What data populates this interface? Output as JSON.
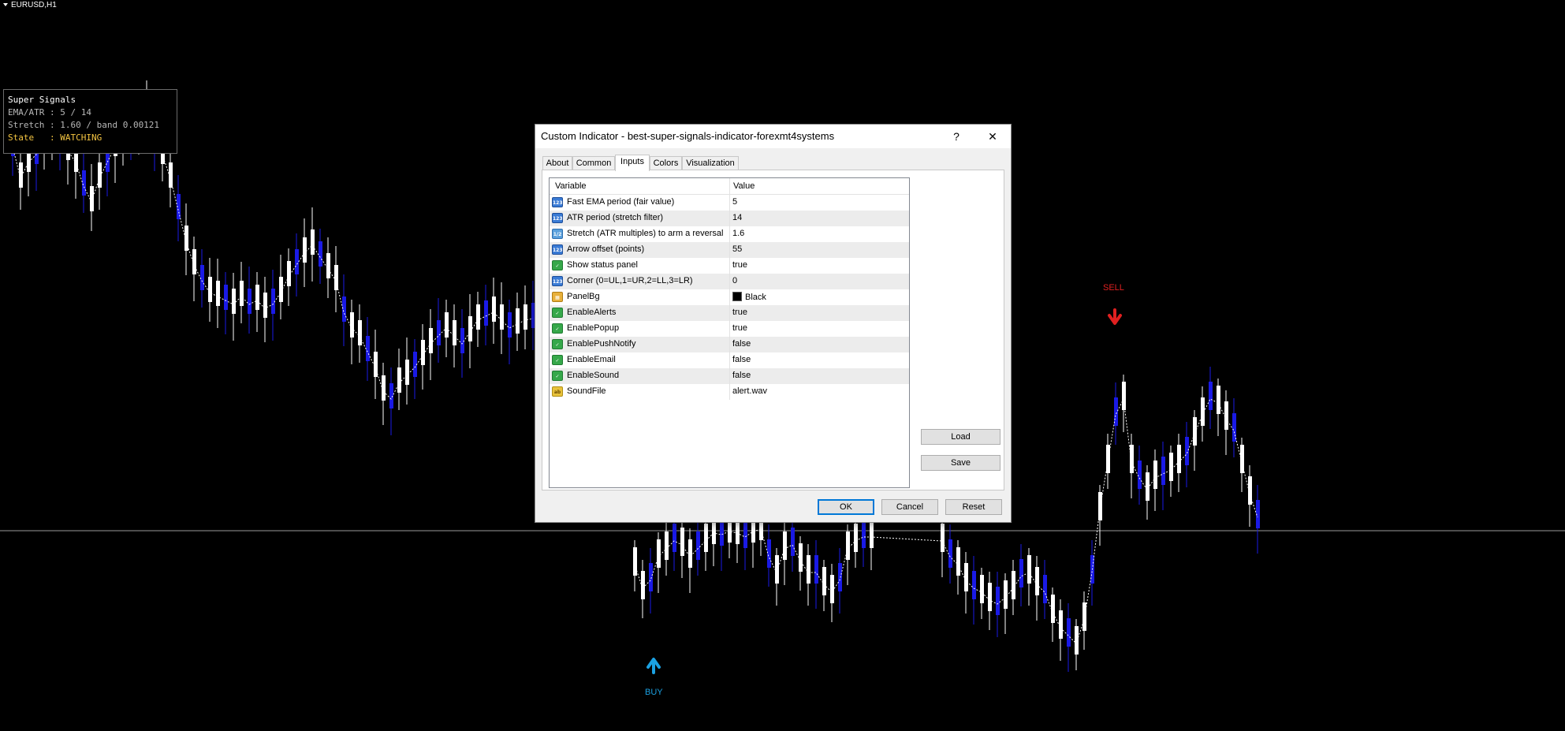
{
  "chart": {
    "symbol": "EURUSD,H1",
    "buy_label": "BUY",
    "sell_label": "SELL",
    "buy_color": "#1ba1e2",
    "sell_color": "#e02020",
    "bull_color": "#ffffff",
    "bear_color": "#1a1ae6"
  },
  "status_panel": {
    "title": "Super Signals",
    "line1": "EMA/ATR : 5 / 14",
    "line2": "Stretch : 1.60 / band 0.00121",
    "line3_prefix": "State   : ",
    "line3_state": "WATCHING"
  },
  "dialog": {
    "title": "Custom Indicator - best-super-signals-indicator-forexmt4systems",
    "help_label": "?",
    "close_label": "✕",
    "tabs": [
      "About",
      "Common",
      "Inputs",
      "Colors",
      "Visualization"
    ],
    "active_tab": "Inputs",
    "columns": {
      "variable": "Variable",
      "value": "Value"
    },
    "rows": [
      {
        "icon": "number-icon",
        "variable": "Fast EMA period (fair value)",
        "value": "5"
      },
      {
        "icon": "number-icon",
        "variable": "ATR period (stretch filter)",
        "value": "14"
      },
      {
        "icon": "double-icon",
        "variable": "Stretch (ATR multiples) to arm a reversal",
        "value": "1.6"
      },
      {
        "icon": "number-icon",
        "variable": "Arrow offset (points)",
        "value": "55"
      },
      {
        "icon": "bool-icon",
        "variable": "Show status panel",
        "value": "true"
      },
      {
        "icon": "number-icon",
        "variable": "Corner (0=UL,1=UR,2=LL,3=LR)",
        "value": "0"
      },
      {
        "icon": "color-icon",
        "variable": "PanelBg",
        "value": "Black"
      },
      {
        "icon": "bool-icon",
        "variable": "EnableAlerts",
        "value": "true"
      },
      {
        "icon": "bool-icon",
        "variable": "EnablePopup",
        "value": "true"
      },
      {
        "icon": "bool-icon",
        "variable": "EnablePushNotify",
        "value": "false"
      },
      {
        "icon": "bool-icon",
        "variable": "EnableEmail",
        "value": "false"
      },
      {
        "icon": "bool-icon",
        "variable": "EnableSound",
        "value": "false"
      },
      {
        "icon": "string-icon",
        "variable": "SoundFile",
        "value": "alert.wav"
      }
    ],
    "icon_text": {
      "number-icon": "123",
      "double-icon": "1/2",
      "bool-icon": "✓",
      "color-icon": "▦",
      "string-icon": "ab"
    },
    "load_label": "Load",
    "save_label": "Save",
    "ok_label": "OK",
    "cancel_label": "Cancel",
    "reset_label": "Reset"
  }
}
